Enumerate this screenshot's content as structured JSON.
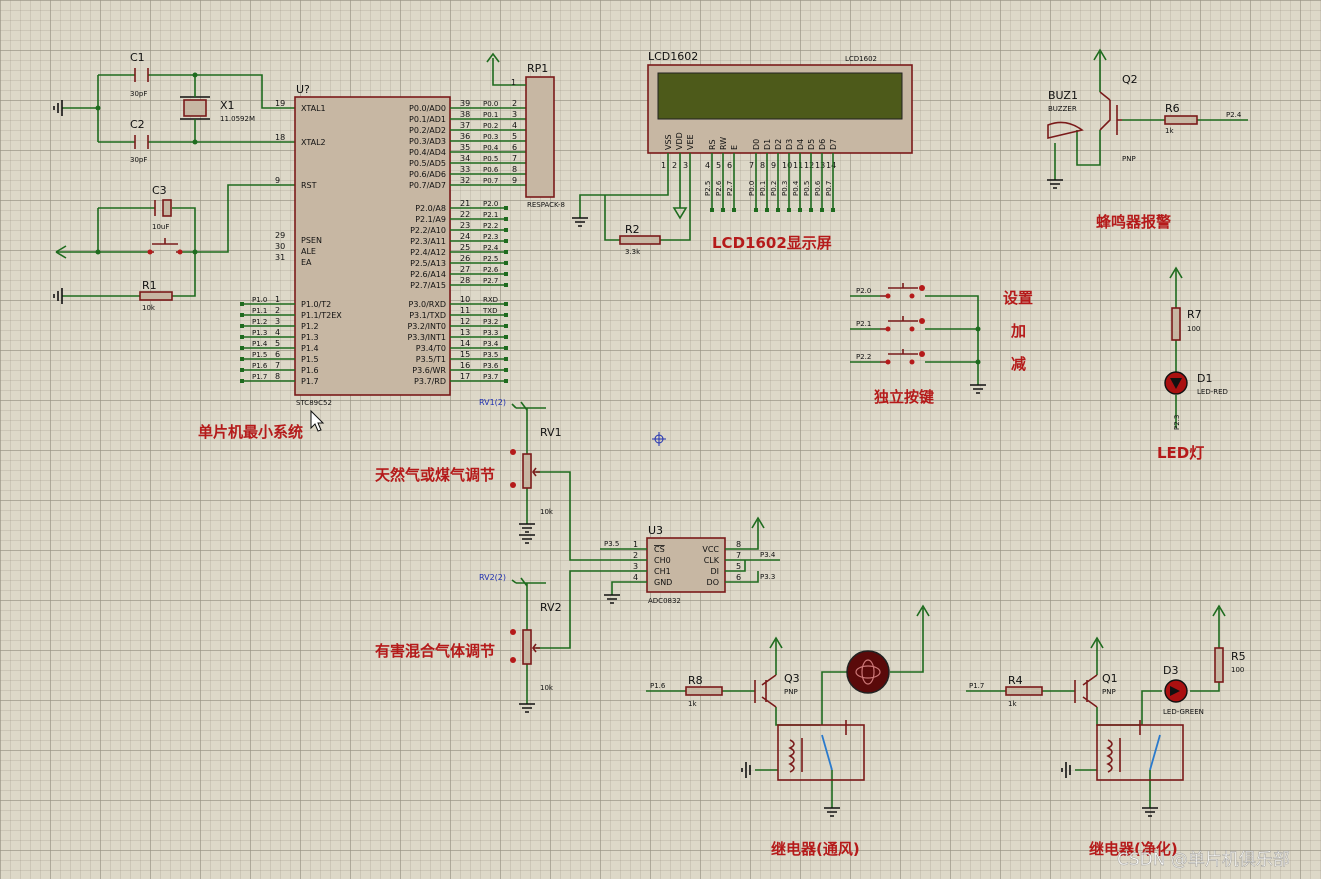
{
  "components": {
    "c1": {
      "ref": "C1",
      "value": "30pF"
    },
    "c2": {
      "ref": "C2",
      "value": "30pF"
    },
    "c3": {
      "ref": "C3",
      "value": "10uF"
    },
    "x1": {
      "ref": "X1",
      "value": "11.0592M"
    },
    "r1": {
      "ref": "R1",
      "value": "10k"
    },
    "r2": {
      "ref": "R2",
      "value": "3.3k"
    },
    "r4": {
      "ref": "R4",
      "value": "1k"
    },
    "r5": {
      "ref": "R5",
      "value": "100"
    },
    "r6": {
      "ref": "R6",
      "value": "1k"
    },
    "r7": {
      "ref": "R7",
      "value": "100"
    },
    "r8": {
      "ref": "R8",
      "value": "1k"
    },
    "u_mcu": {
      "ref": "U?",
      "value": "STC89C52"
    },
    "rp1": {
      "ref": "RP1",
      "value": "RESPACK-8"
    },
    "lcd": {
      "ref": "LCD1602",
      "value": "LCD1602"
    },
    "u3": {
      "ref": "U3",
      "value": "ADC0832"
    },
    "buz1": {
      "ref": "BUZ1",
      "value": "BUZZER"
    },
    "q1": {
      "ref": "Q1",
      "value": "PNP"
    },
    "q2": {
      "ref": "Q2",
      "value": "PNP"
    },
    "q3": {
      "ref": "Q3",
      "value": "PNP"
    },
    "d1": {
      "ref": "D1",
      "value": "LED-RED"
    },
    "d3": {
      "ref": "D3",
      "value": "LED-GREEN"
    },
    "rv1": {
      "ref": "RV1",
      "value": "10k",
      "probe": "RV1(2)"
    },
    "rv2": {
      "ref": "RV2",
      "value": "10k",
      "probe": "RV2(2)"
    }
  },
  "mcu_pins_left": [
    {
      "num": "19",
      "name": "XTAL1"
    },
    {
      "num": "18",
      "name": "XTAL2"
    },
    {
      "num": "9",
      "name": "RST"
    },
    {
      "num": "29",
      "name": "PSEN"
    },
    {
      "num": "30",
      "name": "ALE"
    },
    {
      "num": "31",
      "name": "EA"
    },
    {
      "num": "1",
      "name": "P1.0/T2"
    },
    {
      "num": "2",
      "name": "P1.1/T2EX"
    },
    {
      "num": "3",
      "name": "P1.2"
    },
    {
      "num": "4",
      "name": "P1.3"
    },
    {
      "num": "5",
      "name": "P1.4"
    },
    {
      "num": "6",
      "name": "P1.5"
    },
    {
      "num": "7",
      "name": "P1.6"
    },
    {
      "num": "8",
      "name": "P1.7"
    }
  ],
  "mcu_pins_right": [
    {
      "num": "39",
      "name": "P0.0/AD0"
    },
    {
      "num": "38",
      "name": "P0.1/AD1"
    },
    {
      "num": "37",
      "name": "P0.2/AD2"
    },
    {
      "num": "36",
      "name": "P0.3/AD3"
    },
    {
      "num": "35",
      "name": "P0.4/AD4"
    },
    {
      "num": "34",
      "name": "P0.5/AD5"
    },
    {
      "num": "33",
      "name": "P0.6/AD6"
    },
    {
      "num": "32",
      "name": "P0.7/AD7"
    },
    {
      "num": "21",
      "name": "P2.0/A8"
    },
    {
      "num": "22",
      "name": "P2.1/A9"
    },
    {
      "num": "23",
      "name": "P2.2/A10"
    },
    {
      "num": "24",
      "name": "P2.3/A11"
    },
    {
      "num": "25",
      "name": "P2.4/A12"
    },
    {
      "num": "26",
      "name": "P2.5/A13"
    },
    {
      "num": "27",
      "name": "P2.6/A14"
    },
    {
      "num": "28",
      "name": "P2.7/A15"
    },
    {
      "num": "10",
      "name": "P3.0/RXD"
    },
    {
      "num": "11",
      "name": "P3.1/TXD"
    },
    {
      "num": "12",
      "name": "P3.2/INT0"
    },
    {
      "num": "13",
      "name": "P3.3/INT1"
    },
    {
      "num": "14",
      "name": "P3.4/T0"
    },
    {
      "num": "15",
      "name": "P3.5/T1"
    },
    {
      "num": "16",
      "name": "P3.6/WR"
    },
    {
      "num": "17",
      "name": "P3.7/RD"
    }
  ],
  "net_left": [
    "P1.0",
    "P1.1",
    "P1.2",
    "P1.3",
    "P1.4",
    "P1.5",
    "P1.6",
    "P1.7"
  ],
  "net_right": [
    "P0.0",
    "P0.1",
    "P0.2",
    "P0.3",
    "P0.4",
    "P0.5",
    "P0.6",
    "P0.7",
    "P2.0",
    "P2.1",
    "P2.2",
    "P2.3",
    "P2.4",
    "P2.5",
    "P2.6",
    "P2.7",
    "RXD",
    "TXD",
    "P3.2",
    "P3.3",
    "P3.4",
    "P3.5",
    "P3.6",
    "P3.7"
  ],
  "lcd_pins": [
    "VSS",
    "VDD",
    "VEE",
    "RS",
    "RW",
    "E",
    "D0",
    "D1",
    "D2",
    "D3",
    "D4",
    "D5",
    "D6",
    "D7"
  ],
  "lcd_pin_nums": [
    "1",
    "2",
    "3",
    "4",
    "5",
    "6",
    "7",
    "8",
    "9",
    "10",
    "11",
    "12",
    "13",
    "14"
  ],
  "lcd_nets": [
    "P2.5",
    "P2.6",
    "P2.7",
    "P0.0",
    "P0.1",
    "P0.2",
    "P0.3",
    "P0.4",
    "P0.5",
    "P0.6",
    "P0.7"
  ],
  "adc_pins_left": [
    {
      "num": "1",
      "name": "CS"
    },
    {
      "num": "2",
      "name": "CH0"
    },
    {
      "num": "3",
      "name": "CH1"
    },
    {
      "num": "4",
      "name": "GND"
    }
  ],
  "adc_pins_right": [
    {
      "num": "8",
      "name": "VCC"
    },
    {
      "num": "7",
      "name": "CLK"
    },
    {
      "num": "5",
      "name": "DI"
    },
    {
      "num": "6",
      "name": "DO"
    }
  ],
  "nets": {
    "adc_cs": "P3.5",
    "adc_clk": "P3.4",
    "adc_do": "P3.3",
    "buzzer": "P2.4",
    "led_red": "P2.3",
    "relay1": "P1.6",
    "relay2": "P1.7",
    "key1": "P2.0",
    "key2": "P2.1",
    "key3": "P2.2"
  },
  "labels": {
    "mcu_system": "单片机最小系统",
    "lcd_screen": "LCD1602显示屏",
    "buzzer_alarm": "蜂鸣器报警",
    "key_set": "设置",
    "key_add": "加",
    "key_sub": "减",
    "keys": "独立按键",
    "led": "LED灯",
    "gas1": "天然气或煤气调节",
    "gas2": "有害混合气体调节",
    "relay_vent": "继电器(通风)",
    "relay_purify": "继电器(净化)",
    "watermark": "CSDN @单片机俱乐部"
  },
  "colors": {
    "background": "#ddd8c8",
    "wire": "#1e6b1e",
    "component": "#7a1a1a",
    "label": "#b51a1a",
    "lcd_screen": "#4d5a1a"
  }
}
